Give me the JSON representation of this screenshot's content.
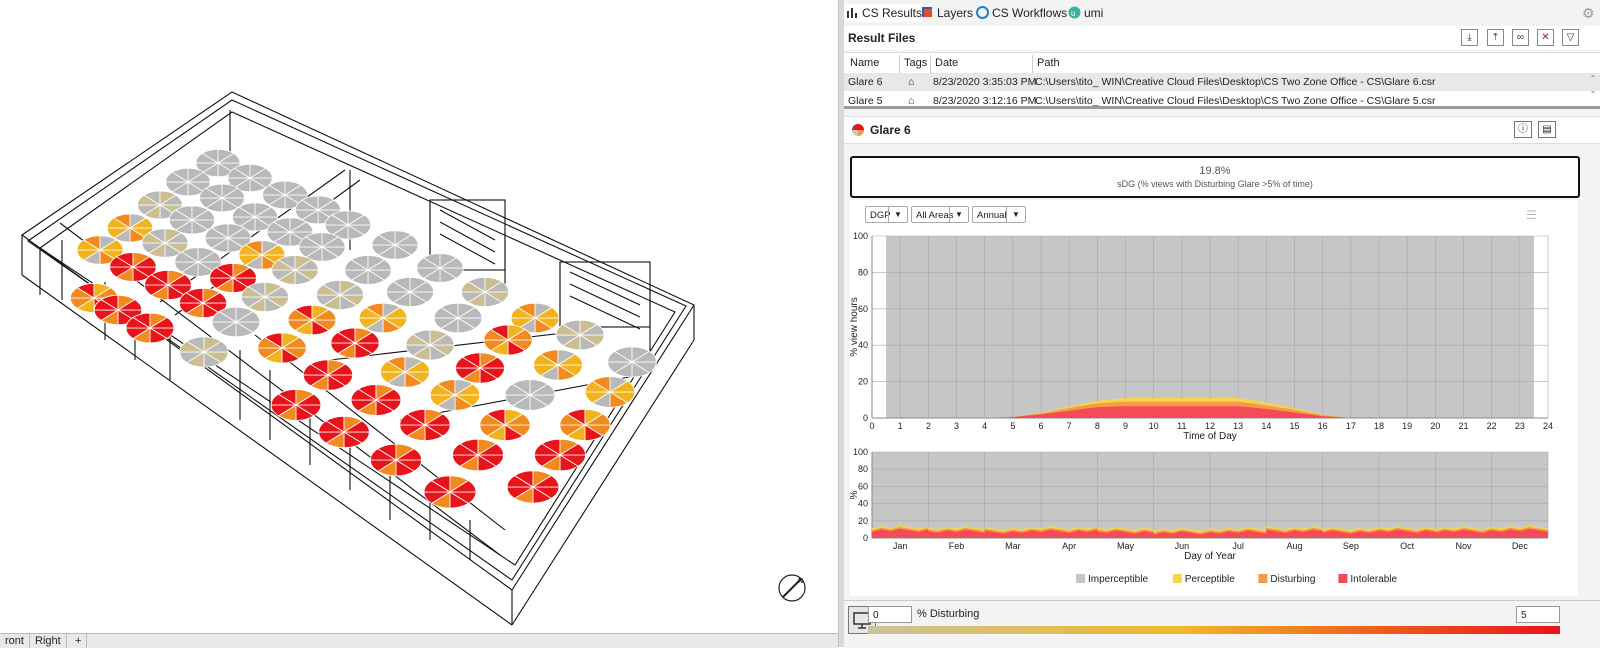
{
  "viewport_tabs": [
    "ront",
    "Right",
    "+"
  ],
  "panel_tabs": [
    {
      "label": "CS Results",
      "icon": "bar-chart-icon"
    },
    {
      "label": "Layers",
      "icon": "layers-icon"
    },
    {
      "label": "CS Workflows",
      "icon": "workflow-icon"
    },
    {
      "label": "umi",
      "icon": "umi-icon"
    }
  ],
  "result_files": {
    "title": "Result Files",
    "toolbar": [
      "import-icon",
      "export-icon",
      "link-icon",
      "close-icon",
      "filter-icon"
    ],
    "columns": [
      "Name",
      "Tags",
      "Date",
      "Path"
    ],
    "rows": [
      {
        "name": "Glare 6",
        "tags": "tag-icon",
        "date": "8/23/2020 3:35:03 PM",
        "path": "C:\\Users\\tito_ WIN\\Creative Cloud Files\\Desktop\\CS Two Zone Office - CS\\Glare 6.csr"
      },
      {
        "name": "Glare 5",
        "tags": "tag-icon",
        "date": "8/23/2020 3:12:16 PM",
        "path": "C:\\Users\\tito_ WIN\\Creative Cloud Files\\Desktop\\CS Two Zone Office - CS\\Glare 5.csr"
      }
    ]
  },
  "glare_panel": {
    "title": "Glare 6",
    "sdg_value": "19.8%",
    "sdg_label": "sDG (% views with Disturbing Glare >5% of time)",
    "dropdowns": {
      "metric": "DGP",
      "area": "All Areas",
      "period": "Annual"
    }
  },
  "colors": {
    "imperceptible": "#c6c6c6",
    "perceptible": "#f7d54a",
    "disturbing": "#f59a4a",
    "intolerable": "#f44c56"
  },
  "chart_data": [
    {
      "type": "area",
      "xlabel": "Time of Day",
      "ylabel": "% view hours",
      "x": [
        0,
        1,
        2,
        3,
        4,
        5,
        6,
        7,
        8,
        9,
        10,
        11,
        12,
        13,
        14,
        15,
        16,
        17,
        18,
        19,
        20,
        21,
        22,
        23,
        24
      ],
      "ylim": [
        0,
        100
      ],
      "series": [
        {
          "name": "Intolerable",
          "values": [
            0,
            0,
            0,
            0,
            0,
            0.5,
            2,
            4,
            6,
            6.5,
            6.5,
            6.5,
            6.5,
            6.5,
            5,
            3,
            1,
            0,
            0,
            0,
            0,
            0,
            0,
            0,
            0
          ]
        },
        {
          "name": "Disturbing",
          "values": [
            0,
            0,
            0,
            0,
            0,
            0,
            0.5,
            1.5,
            2,
            2.5,
            2.5,
            2.5,
            2.5,
            2.5,
            2,
            1.5,
            0.5,
            0,
            0,
            0,
            0,
            0,
            0,
            0,
            0
          ]
        },
        {
          "name": "Perceptible",
          "values": [
            0,
            0,
            0,
            0,
            0,
            0,
            0.3,
            1,
            1.5,
            2,
            2,
            2,
            2,
            2,
            1.5,
            1,
            0.3,
            0,
            0,
            0,
            0,
            0,
            0,
            0,
            0
          ]
        }
      ],
      "xticks": [
        "0",
        "1",
        "2",
        "3",
        "4",
        "5",
        "6",
        "7",
        "8",
        "9",
        "10",
        "11",
        "12",
        "13",
        "14",
        "15",
        "16",
        "17",
        "18",
        "19",
        "20",
        "21",
        "22",
        "23",
        "24"
      ],
      "yticks": [
        "0",
        "20",
        "40",
        "60",
        "80",
        "100"
      ]
    },
    {
      "type": "area",
      "xlabel": "Day of Year",
      "ylabel": "%",
      "categories": [
        "Jan",
        "Feb",
        "Mar",
        "Apr",
        "May",
        "Jun",
        "Jul",
        "Aug",
        "Sep",
        "Oct",
        "Nov",
        "Dec"
      ],
      "ylim": [
        0,
        100
      ],
      "series": [
        {
          "name": "Intolerable",
          "values": [
            9,
            8,
            7,
            8,
            7,
            6,
            7,
            8,
            7,
            8,
            8,
            9
          ]
        },
        {
          "name": "Disturbing",
          "values": [
            2,
            2,
            2,
            2,
            2,
            2,
            2,
            2,
            2,
            2,
            2,
            2
          ]
        },
        {
          "name": "Perceptible",
          "values": [
            2,
            2,
            2,
            2,
            2,
            2,
            2,
            2,
            2,
            2,
            2,
            2
          ]
        }
      ],
      "yticks": [
        "0",
        "20",
        "40",
        "60",
        "80",
        "100"
      ]
    }
  ],
  "legend": [
    "Imperceptible",
    "Perceptible",
    "Disturbing",
    "Intolerable"
  ],
  "bottom": {
    "min_value": "0",
    "label": "% Disturbing",
    "max_value": "5"
  }
}
